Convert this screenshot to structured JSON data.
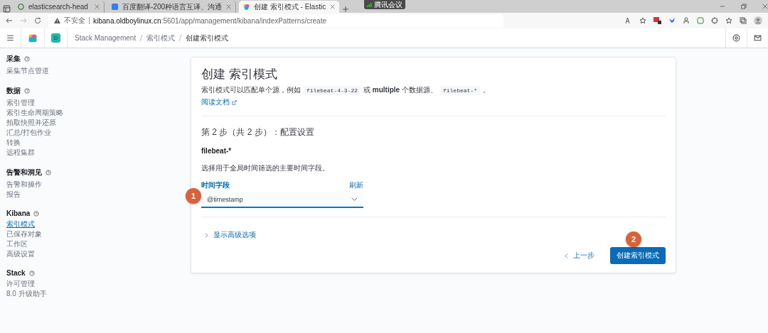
{
  "browser": {
    "tabs": [
      {
        "title": "elasticsearch-head",
        "selected": false
      },
      {
        "title": "百度翻译-200种语言互译、沟通",
        "selected": false
      },
      {
        "title": "创建 索引模式 - Elastic",
        "selected": true
      }
    ],
    "meeting_badge": "腾讯会议",
    "address": {
      "security": "不安全",
      "host": "kibana.oldboylinux.cn",
      "path": ":5601/app/management/kibana/indexPatterns/create"
    }
  },
  "header": {
    "avatar": "D",
    "breadcrumbs": [
      "Stack Management",
      "索引模式",
      "创建索引模式"
    ]
  },
  "sidebar": {
    "sections": [
      {
        "title": "采集",
        "items": [
          {
            "label": "采集节点管道",
            "selected": false
          }
        ]
      },
      {
        "title": "数据",
        "items": [
          {
            "label": "索引管理",
            "selected": false
          },
          {
            "label": "索引生命周期策略",
            "selected": false
          },
          {
            "label": "拍取快照并还原",
            "selected": false
          },
          {
            "label": "汇总/打包作业",
            "selected": false
          },
          {
            "label": "转换",
            "selected": false
          },
          {
            "label": "远程集群",
            "selected": false
          }
        ]
      },
      {
        "title": "告警和洞见",
        "items": [
          {
            "label": "告警和操作",
            "selected": false
          },
          {
            "label": "报告",
            "selected": false
          }
        ]
      },
      {
        "title": "Kibana",
        "items": [
          {
            "label": "索引模式",
            "selected": true
          },
          {
            "label": "已保存对象",
            "selected": false
          },
          {
            "label": "工作区",
            "selected": false
          },
          {
            "label": "高级设置",
            "selected": false
          }
        ]
      },
      {
        "title": "Stack",
        "items": [
          {
            "label": "许可管理",
            "selected": false
          },
          {
            "label": "8.0 升级助手",
            "selected": false
          }
        ]
      }
    ]
  },
  "panel": {
    "title": "创建 索引模式",
    "description": [
      {
        "kind": "text",
        "text": "索引模式可以匹配单个源，例如"
      },
      {
        "kind": "code",
        "text": "filebeat-4-3-22"
      },
      {
        "kind": "text",
        "text": "或 **multiple** 个数据源、"
      },
      {
        "kind": "code",
        "text": "filebeat-*"
      },
      {
        "kind": "text",
        "text": "。"
      }
    ],
    "docs_link": "阅读文档",
    "step_title": "第 2 步（共 2 步）：配置设置",
    "pattern": "filebeat-*",
    "hint": "选择用于全局时间筛选的主要时间字段。",
    "time_field": {
      "label": "时间字段",
      "refresh": "刷新",
      "value": "@timestamp"
    },
    "advanced": "显示高级选项",
    "back_button": "上一步",
    "create_button": "创建索引模式"
  },
  "markers": [
    "1",
    "2"
  ]
}
